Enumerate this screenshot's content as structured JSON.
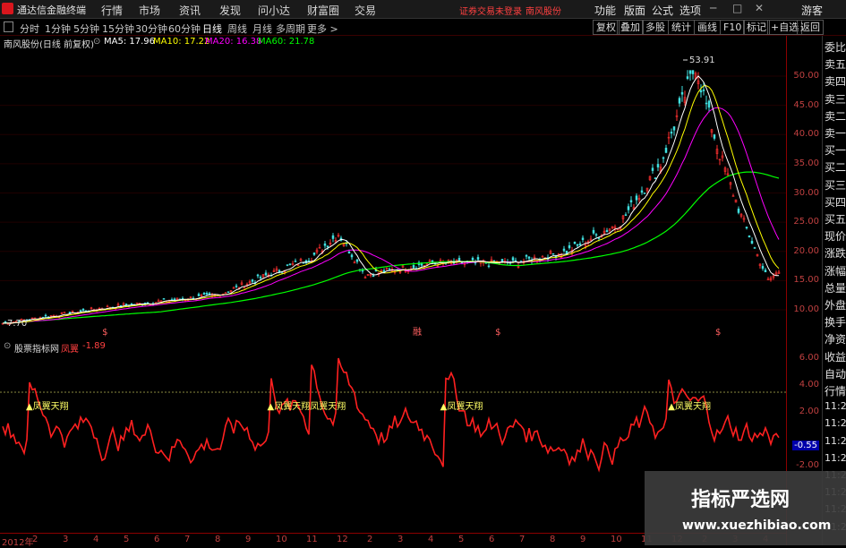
{
  "app": {
    "name": "通达信金融终端"
  },
  "menu": [
    "行情",
    "市场",
    "资讯",
    "发现",
    "问小达",
    "财富圈",
    "交易"
  ],
  "top_notes": {
    "login": "证券交易未登录",
    "stock": "南风股份"
  },
  "right_menu": [
    "功能",
    "版面",
    "公式",
    "选项",
    "游客"
  ],
  "periods": [
    "分时",
    "1分钟",
    "5分钟",
    "15分钟",
    "30分钟",
    "60分钟",
    "日线",
    "周线",
    "月线",
    "多周期",
    "更多 >"
  ],
  "active_period": "日线",
  "tools": [
    "复权",
    "叠加",
    "多股",
    "统计",
    "画线",
    "F10",
    "标记",
    "+自选",
    "返回"
  ],
  "info": {
    "title": "南风股份(日线 前复权)",
    "ma5": "MA5: 17.96",
    "ma10": "MA10: 17.22",
    "ma20": "MA20: 16.38",
    "ma60": "MA60: 21.78"
  },
  "colors": {
    "ma5": "#ffffff",
    "ma10": "#ffff00",
    "ma20": "#ff00ff",
    "ma60": "#00ff00",
    "price_up": "#ff3030",
    "indicator": "#ff2020",
    "axis": "#c04040"
  },
  "price_labels": {
    "high": "53.91",
    "low": "7.70"
  },
  "markers": [
    {
      "label": "$",
      "x_day": 0.13
    },
    {
      "label": "融",
      "x_day": 0.525
    },
    {
      "label": "$",
      "x_day": 0.63
    },
    {
      "label": "$",
      "x_day": 0.91
    }
  ],
  "price_ticks": [
    "50.00",
    "45.00",
    "40.00",
    "35.00",
    "30.00",
    "25.00",
    "20.00",
    "15.00",
    "10.00"
  ],
  "sub": {
    "title": "股票指标网",
    "name": "凤翼",
    "value": "-1.89"
  },
  "sub_ticks": [
    "6.00",
    "4.00",
    "2.00",
    "-0.55",
    "-2.00"
  ],
  "signals": [
    {
      "label": "凤翼天翔",
      "pos": 0.033
    },
    {
      "label": "凤翼天翔凤翼天翔",
      "pos": 0.34
    },
    {
      "label": "凤翼天翔",
      "pos": 0.56
    },
    {
      "label": "凤翼天翔",
      "pos": 0.85
    }
  ],
  "side_labels": [
    "委比",
    "卖五",
    "卖四",
    "卖三",
    "卖二",
    "卖一",
    "买一",
    "买二",
    "买三",
    "买四",
    "买五",
    "现价",
    "涨跌",
    "涨幅",
    "总量",
    "外盘",
    "换手",
    "净资",
    "收益",
    "自动",
    "行情",
    "11:2",
    "11:2",
    "11:2",
    "11:2",
    "11:2",
    "11:2",
    "11:2",
    "11:2"
  ],
  "bottom_ticks": [
    "2012年",
    "2",
    "3",
    "4",
    "5",
    "6",
    "7",
    "8",
    "9",
    "10",
    "11",
    "12",
    "2",
    "3",
    "4",
    "5",
    "6",
    "7",
    "8",
    "9",
    "10",
    "11",
    "12",
    "2",
    "3",
    "4"
  ],
  "watermark": {
    "title": "指标严选网",
    "url": "www.xuezhibiao.com"
  }
}
